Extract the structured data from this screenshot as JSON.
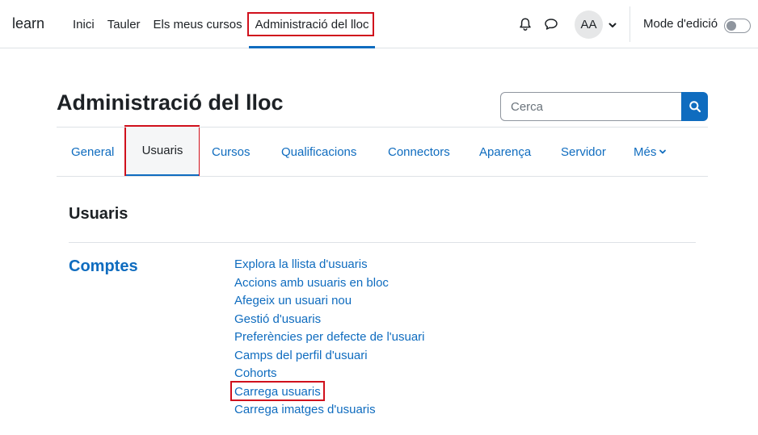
{
  "topbar": {
    "brand": "learn",
    "nav": [
      {
        "label": "Inici"
      },
      {
        "label": "Tauler"
      },
      {
        "label": "Els meus cursos"
      },
      {
        "label": "Administració del lloc",
        "active": true
      }
    ],
    "icons": {
      "notifications": "bell-icon",
      "messages": "chat-bubble-icon",
      "user_menu": "chevron-down-icon"
    },
    "avatar_initials": "AA",
    "edit_mode_label": "Mode d'edició",
    "edit_mode_on": false
  },
  "page": {
    "title": "Administració del lloc",
    "search_placeholder": "Cerca",
    "search_icon": "search-icon"
  },
  "tabs": [
    {
      "label": "General"
    },
    {
      "label": "Usuaris",
      "active": true
    },
    {
      "label": "Cursos"
    },
    {
      "label": "Qualificacions"
    },
    {
      "label": "Connectors"
    },
    {
      "label": "Aparença"
    },
    {
      "label": "Servidor"
    },
    {
      "label": "Més",
      "has_dropdown": true
    }
  ],
  "section": {
    "title": "Usuaris",
    "group_title": "Comptes",
    "links": [
      "Explora la llista d'usuaris",
      "Accions amb usuaris en bloc",
      "Afegeix un usuari nou",
      "Gestió d'usuaris",
      "Preferències per defecte de l'usuari",
      "Camps del perfil d'usuari",
      "Cohorts",
      "Carrega usuaris",
      "Carrega imatges d'usuaris"
    ]
  },
  "colors": {
    "accent": "#0f6cbf",
    "highlight": "#d0101c",
    "text": "#1d2125",
    "border": "#dee2e6"
  }
}
